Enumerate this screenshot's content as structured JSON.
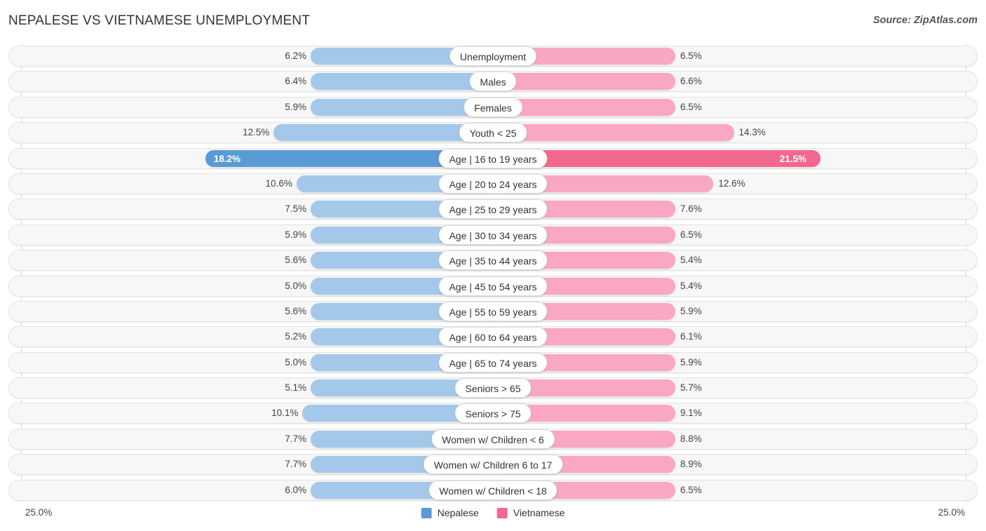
{
  "header": {
    "title": "NEPALESE VS VIETNAMESE UNEMPLOYMENT",
    "source": "Source: ZipAtlas.com"
  },
  "axis": {
    "left_label": "25.0%",
    "right_label": "25.0%",
    "max": 25.0
  },
  "legend": {
    "items": [
      {
        "label": "Nepalese",
        "color": "#5b9bd5"
      },
      {
        "label": "Vietnamese",
        "color": "#f2678f"
      }
    ]
  },
  "colors": {
    "nepalese_light": "#a4c8ea",
    "nepalese_dark": "#5b9bd5",
    "vietnamese_light": "#f9a7c3",
    "vietnamese_dark": "#f2678f",
    "track": "#f7f7f7",
    "track_border": "#e3e3e3"
  },
  "chart_data": {
    "type": "bar",
    "title": "NEPALESE VS VIETNAMESE UNEMPLOYMENT",
    "subtitle": "",
    "xlabel": "",
    "ylabel": "",
    "orientation": "horizontal-diverging",
    "grid": true,
    "legend_position": "bottom-center",
    "xlim": [
      25.0,
      25.0
    ],
    "axis_tick_labels": [
      "25.0%",
      "25.0%"
    ],
    "categories": [
      "Unemployment",
      "Males",
      "Females",
      "Youth < 25",
      "Age | 16 to 19 years",
      "Age | 20 to 24 years",
      "Age | 25 to 29 years",
      "Age | 30 to 34 years",
      "Age | 35 to 44 years",
      "Age | 45 to 54 years",
      "Age | 55 to 59 years",
      "Age | 60 to 64 years",
      "Age | 65 to 74 years",
      "Seniors > 65",
      "Seniors > 75",
      "Women w/ Children < 6",
      "Women w/ Children 6 to 17",
      "Women w/ Children < 18"
    ],
    "series": [
      {
        "name": "Nepalese",
        "color": "#5b9bd5",
        "values": [
          6.2,
          6.4,
          5.9,
          12.5,
          18.2,
          10.6,
          7.5,
          5.9,
          5.6,
          5.0,
          5.6,
          5.2,
          5.0,
          5.1,
          10.1,
          7.7,
          7.7,
          6.0
        ],
        "labels": [
          "6.2%",
          "6.4%",
          "5.9%",
          "12.5%",
          "18.2%",
          "10.6%",
          "7.5%",
          "5.9%",
          "5.6%",
          "5.0%",
          "5.6%",
          "5.2%",
          "5.0%",
          "5.1%",
          "10.1%",
          "7.7%",
          "7.7%",
          "6.0%"
        ]
      },
      {
        "name": "Vietnamese",
        "color": "#f2678f",
        "values": [
          6.5,
          6.6,
          6.5,
          14.3,
          21.5,
          12.6,
          7.6,
          6.5,
          5.4,
          5.4,
          5.9,
          6.1,
          5.9,
          5.7,
          9.1,
          8.8,
          8.9,
          6.5
        ],
        "labels": [
          "6.5%",
          "6.6%",
          "6.5%",
          "14.3%",
          "21.5%",
          "12.6%",
          "7.6%",
          "6.5%",
          "5.4%",
          "5.4%",
          "5.9%",
          "6.1%",
          "5.9%",
          "5.7%",
          "9.1%",
          "8.8%",
          "8.9%",
          "6.5%"
        ]
      }
    ],
    "highlighted_row": "Age | 16 to 19 years"
  },
  "rows": [
    {
      "category": "Unemployment",
      "left": "6.2%",
      "right": "6.5%",
      "lv": 6.2,
      "rv": 6.5,
      "accent": false
    },
    {
      "category": "Males",
      "left": "6.4%",
      "right": "6.6%",
      "lv": 6.4,
      "rv": 6.6,
      "accent": false
    },
    {
      "category": "Females",
      "left": "5.9%",
      "right": "6.5%",
      "lv": 5.9,
      "rv": 6.5,
      "accent": false
    },
    {
      "category": "Youth < 25",
      "left": "12.5%",
      "right": "14.3%",
      "lv": 12.5,
      "rv": 14.3,
      "accent": false
    },
    {
      "category": "Age | 16 to 19 years",
      "left": "18.2%",
      "right": "21.5%",
      "lv": 18.2,
      "rv": 21.5,
      "accent": true
    },
    {
      "category": "Age | 20 to 24 years",
      "left": "10.6%",
      "right": "12.6%",
      "lv": 10.6,
      "rv": 12.6,
      "accent": false
    },
    {
      "category": "Age | 25 to 29 years",
      "left": "7.5%",
      "right": "7.6%",
      "lv": 7.5,
      "rv": 7.6,
      "accent": false
    },
    {
      "category": "Age | 30 to 34 years",
      "left": "5.9%",
      "right": "6.5%",
      "lv": 5.9,
      "rv": 6.5,
      "accent": false
    },
    {
      "category": "Age | 35 to 44 years",
      "left": "5.6%",
      "right": "5.4%",
      "lv": 5.6,
      "rv": 5.4,
      "accent": false
    },
    {
      "category": "Age | 45 to 54 years",
      "left": "5.0%",
      "right": "5.4%",
      "lv": 5.0,
      "rv": 5.4,
      "accent": false
    },
    {
      "category": "Age | 55 to 59 years",
      "left": "5.6%",
      "right": "5.9%",
      "lv": 5.6,
      "rv": 5.9,
      "accent": false
    },
    {
      "category": "Age | 60 to 64 years",
      "left": "5.2%",
      "right": "6.1%",
      "lv": 5.2,
      "rv": 6.1,
      "accent": false
    },
    {
      "category": "Age | 65 to 74 years",
      "left": "5.0%",
      "right": "5.9%",
      "lv": 5.0,
      "rv": 5.9,
      "accent": false
    },
    {
      "category": "Seniors > 65",
      "left": "5.1%",
      "right": "5.7%",
      "lv": 5.1,
      "rv": 5.7,
      "accent": false
    },
    {
      "category": "Seniors > 75",
      "left": "10.1%",
      "right": "9.1%",
      "lv": 10.1,
      "rv": 9.1,
      "accent": false
    },
    {
      "category": "Women w/ Children < 6",
      "left": "7.7%",
      "right": "8.8%",
      "lv": 7.7,
      "rv": 8.8,
      "accent": false
    },
    {
      "category": "Women w/ Children 6 to 17",
      "left": "7.7%",
      "right": "8.9%",
      "lv": 7.7,
      "rv": 8.9,
      "accent": false
    },
    {
      "category": "Women w/ Children < 18",
      "left": "6.0%",
      "right": "6.5%",
      "lv": 6.0,
      "rv": 6.5,
      "accent": false
    }
  ]
}
